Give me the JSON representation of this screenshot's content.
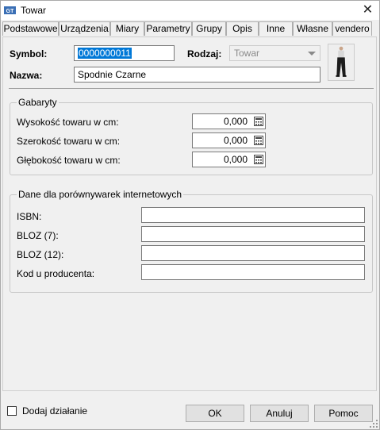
{
  "window": {
    "title": "Towar"
  },
  "tabs": [
    {
      "label": "Podstawowe"
    },
    {
      "label": "Urządzenia"
    },
    {
      "label": "Miary"
    },
    {
      "label": "Parametry"
    },
    {
      "label": "Grupy"
    },
    {
      "label": "Opis"
    },
    {
      "label": "Inne"
    },
    {
      "label": "Własne"
    },
    {
      "label": "vendero"
    }
  ],
  "active_tab": "Miary",
  "header": {
    "symbol_label": "Symbol:",
    "symbol_value": "0000000011",
    "rodzaj_label": "Rodzaj:",
    "rodzaj_value": "Towar",
    "nazwa_label": "Nazwa:",
    "nazwa_value": "Spodnie Czarne"
  },
  "gabaryty": {
    "title": "Gabaryty",
    "rows": [
      {
        "label": "Wysokość towaru w cm:",
        "value": "0,000"
      },
      {
        "label": "Szerokość towaru w cm:",
        "value": "0,000"
      },
      {
        "label": "Głębokość towaru w cm:",
        "value": "0,000"
      }
    ]
  },
  "porownywarki": {
    "title": "Dane dla porównywarek internetowych",
    "rows": [
      {
        "label": "ISBN:",
        "value": ""
      },
      {
        "label": "BLOZ (7):",
        "value": ""
      },
      {
        "label": "BLOZ (12):",
        "value": ""
      },
      {
        "label": "Kod u producenta:",
        "value": ""
      }
    ]
  },
  "footer": {
    "dodaj_label": "Dodaj działanie",
    "ok_label": "OK",
    "anuluj_label": "Anuluj",
    "pomoc_label": "Pomoc"
  },
  "colors": {
    "selection": "#0078d7",
    "app_icon": "#3a6fb5",
    "window_bg": "#f0f0f0"
  }
}
